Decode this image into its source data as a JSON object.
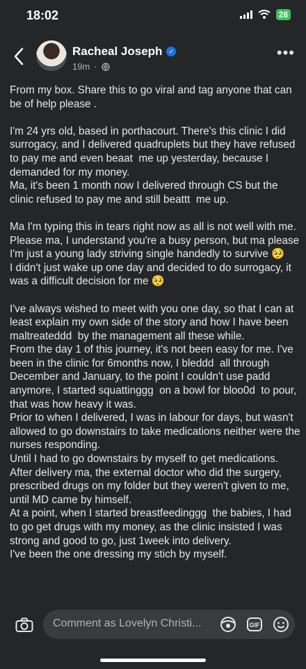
{
  "status": {
    "time": "18:02",
    "battery": "28"
  },
  "post": {
    "author": "Racheal Joseph",
    "time": "19m",
    "paragraphs": [
      "From my box. Share this to go viral and tag anyone that can be of help please .",
      "",
      "I'm 24 yrs old, based in porthacourt. There's this clinic I did surrogacy, and I delivered quadruplets but they have refused to pay me and even beaat  me up yesterday, because I demanded for my money.",
      "Ma, it's been 1 month now I delivered through CS but the clinic refused to pay me and still beattt  me up.",
      "",
      "Ma I'm typing this in tears right now as all is not well with me.",
      "Please ma, I understand you're a busy person, but ma please I'm just a young lady striving single handedly to survive 🥺",
      "I didn't just wake up one day and decided to do surrogacy, it was a difficult decision for me 🥺",
      "",
      "I've always wished to meet with you one day, so that I can at least explain my own side of the story and how I have been maltreateddd  by the management all these while.",
      "From the day 1 of this journey, it's not been easy for me. I've been in the clinic for 6months now, I bleddd  all through December and January, to the point I couldn't use padd anymore, I started squattinggg  on a bowl for bloo0d  to pour, that was how heavy it was.",
      "Prior to when I delivered, I was in labour for days, but wasn't allowed to go downstairs to take medications neither were the nurses responding.",
      "Until I had to go downstairs by myself to get medications.",
      "After delivery ma, the external doctor who did the surgery, prescribed drugs on my folder but they weren't given to me, until MD came by himself.",
      "At a point, when I started breastfeedinggg  the babies, I had to go get drugs with my money, as the clinic insisted I was strong and good to go, just 1week into delivery.",
      "I've been the one dressing my stich by myself."
    ]
  },
  "comment": {
    "placeholder": "Comment as Lovelyn Christi..."
  },
  "icons": {
    "back": "chevron-left-icon",
    "more": "more-horizontal-icon",
    "camera": "camera-icon",
    "avatar_frame": "avatar-frame-icon",
    "gif": "gif-icon",
    "emoji": "emoji-icon"
  },
  "colors": {
    "background": "#252628",
    "text": "#e4e6eb",
    "verified": "#1b74e4",
    "input_bg": "#3a3b3d"
  }
}
